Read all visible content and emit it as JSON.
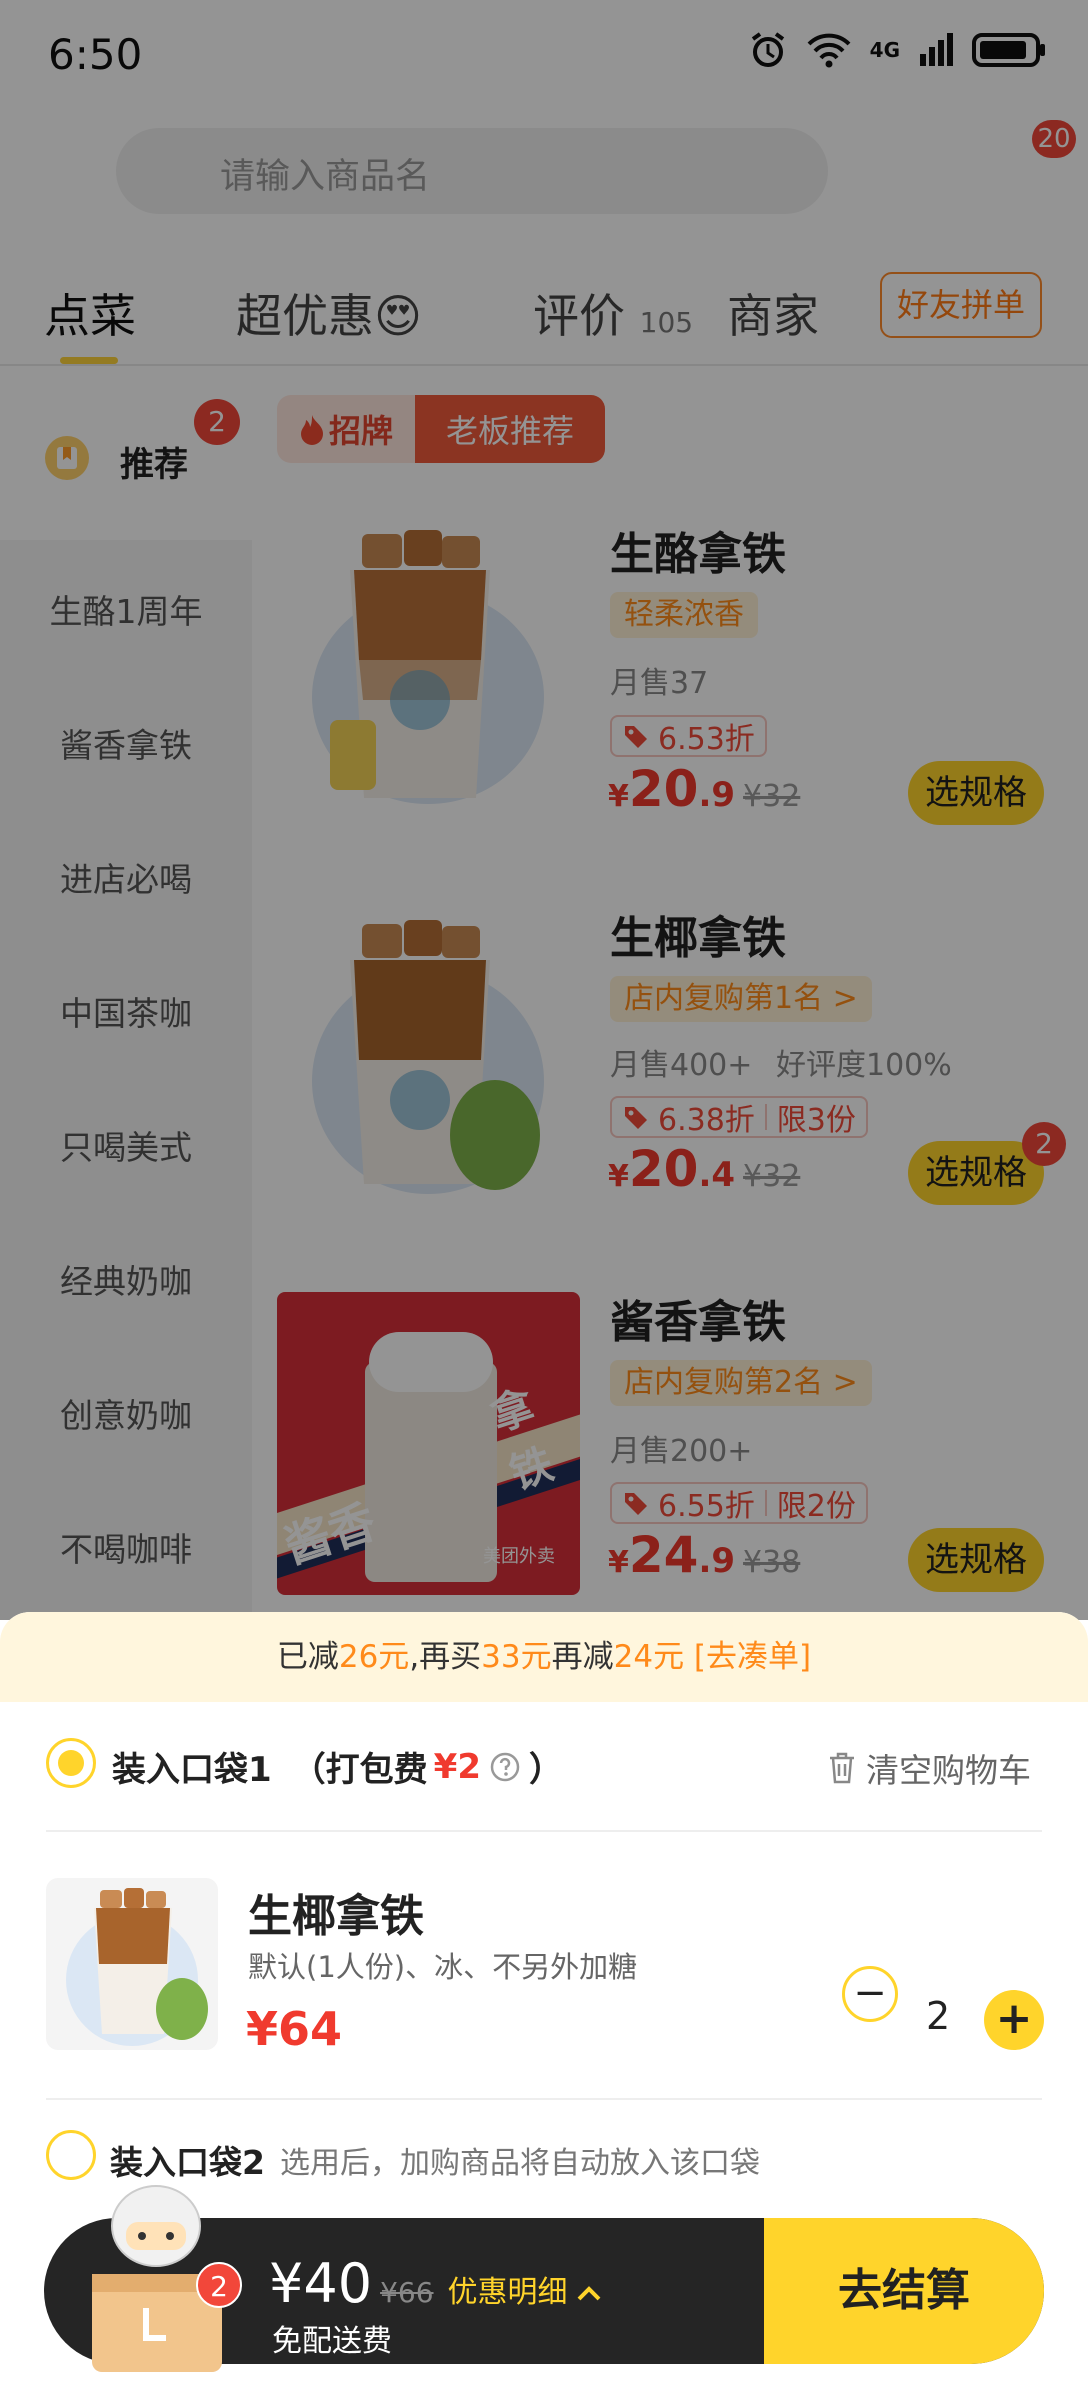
{
  "status": {
    "time": "6:50",
    "network": "4G"
  },
  "search": {
    "placeholder": "请输入商品名"
  },
  "top_badge": "20",
  "tabs": [
    {
      "label": "点菜",
      "emoji": ""
    },
    {
      "label": "超优惠",
      "emoji": "😍"
    },
    {
      "label": "评价",
      "count": "105"
    },
    {
      "label": "商家"
    }
  ],
  "friend_button": "好友拼单",
  "sidebar": {
    "recommend": {
      "label": "推荐",
      "badge": "2"
    },
    "items": [
      "生酪1周年",
      "酱香拿铁",
      "进店必喝",
      "中国茶咖",
      "只喝美式",
      "经典奶咖",
      "创意奶咖",
      "不喝咖啡"
    ]
  },
  "section_pill": {
    "left": "招牌",
    "right": "老板推荐"
  },
  "products": [
    {
      "name": "生酪拿铁",
      "tag": "轻柔浓香",
      "sold": "月售37",
      "rating": "",
      "discount": "6.53折",
      "limit": "",
      "price_int": "20",
      "price_dec": ".9",
      "old_price": "¥32",
      "button": "选规格",
      "badge": ""
    },
    {
      "name": "生椰拿铁",
      "tag": "店内复购第1名 >",
      "sold": "月售400+",
      "rating": "好评度100%",
      "discount": "6.38折",
      "limit": "限3份",
      "price_int": "20",
      "price_dec": ".4",
      "old_price": "¥32",
      "button": "选规格",
      "badge": "2"
    },
    {
      "name": "酱香拿铁",
      "tag": "店内复购第2名 >",
      "sold": "月售200+",
      "rating": "",
      "discount": "6.55折",
      "limit": "限2份",
      "price_int": "24",
      "price_dec": ".9",
      "old_price": "¥38",
      "button": "选规格",
      "badge": ""
    }
  ],
  "product3_image_text": {
    "jiang": "酱香",
    "latte": "拿铁",
    "brand": "美团外卖"
  },
  "promo": {
    "p1": "已减",
    "v1": "26元",
    "p2": ",再买",
    "v2": "33元",
    "p3": "再减",
    "v3": "24元",
    "link": " [去凑单]"
  },
  "bag1": {
    "label": "装入口袋1",
    "fee_label": "（打包费",
    "fee": "¥2",
    "close": "）",
    "clear": "清空购物车"
  },
  "cart_item": {
    "name": "生椰拿铁",
    "spec": "默认(1人份)、冰、不另外加糖",
    "price": "¥64",
    "qty": "2"
  },
  "bag2": {
    "label": "装入口袋2",
    "hint": "选用后，加购商品将自动放入该口袋"
  },
  "cart_bar": {
    "badge": "2",
    "total": "¥40",
    "old": "¥66",
    "detail": "优惠明细",
    "delivery": "免配送费",
    "checkout": "去结算"
  },
  "colors": {
    "accent": "#ffd42b",
    "price": "#f03a2e",
    "orange": "#ff8a1a"
  }
}
